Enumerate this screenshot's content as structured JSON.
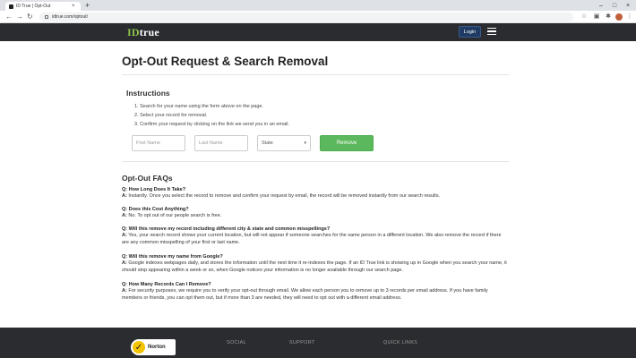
{
  "browser": {
    "tab_title": "ID True | Opt-Out",
    "tab_close": "×",
    "new_tab": "+",
    "window_controls": [
      "–",
      "□",
      "×"
    ],
    "back": "←",
    "forward": "→",
    "reload": "↻",
    "url": "idtrue.com/optout/",
    "toolbar_icons": [
      "star-icon",
      "reading-list-icon",
      "extension-icon",
      "menu-dots-icon"
    ],
    "toolbar_glyphs": [
      "☆",
      "▣",
      "✱",
      "⋮"
    ]
  },
  "header": {
    "logo_id": "ID",
    "logo_true": "true",
    "login_label": "Login"
  },
  "main": {
    "title": "Opt-Out Request & Search Removal",
    "instructions_title": "Instructions",
    "steps": [
      "1. Search for your name using the form above on the page.",
      "2. Select your record for removal.",
      "3. Confirm your request by clicking on the link we send you in an email."
    ],
    "form": {
      "first_name_placeholder": "First Name",
      "last_name_placeholder": "Last Name",
      "state_label": "State",
      "remove_label": "Remove"
    }
  },
  "faqs": {
    "title": "Opt-Out FAQs",
    "items": [
      {
        "q": "Q: How Long Does It Take?",
        "a_prefix": "A:",
        "a": "Instantly. Once you select the record to remove and confirm your request by email, the record will be removed instantly from our search results."
      },
      {
        "q": "Q: Does this Cost Anything?",
        "a_prefix": "A:",
        "a": "No. To opt out of our people search is free."
      },
      {
        "q": "Q: Will this remove my record including different city & state and common misspellings?",
        "a_prefix": "A:",
        "a": "Yes, your search record shows your current location, but will not appear if someone searches for the same person in a different location. We also remove the record if there are any common misspelling of your first or last name."
      },
      {
        "q": "Q: Will this remove my name from Google?",
        "a_prefix": "A:",
        "a": "Google indexes webpages daily, and stores the information until the next time it re-indexes the page. If an ID True link is showing up in Google when you search your name, it should stop appearing within a week or so, when Google notices your information is no longer available through our search page."
      },
      {
        "q": "Q: How Many Records Can I Remove?",
        "a_prefix": "A:",
        "a": "For security purposes, we require you to verify your opt-out through email. We allow each person you to remove up to 3 records per email address. If you have family members or friends, you can opt them out, but if more than 3 are needed, they will need to opt out with a different email address."
      }
    ]
  },
  "footer": {
    "norton_label": "Norton",
    "columns": [
      "SOCIAL",
      "SUPPORT",
      "QUICK LINKS"
    ]
  }
}
